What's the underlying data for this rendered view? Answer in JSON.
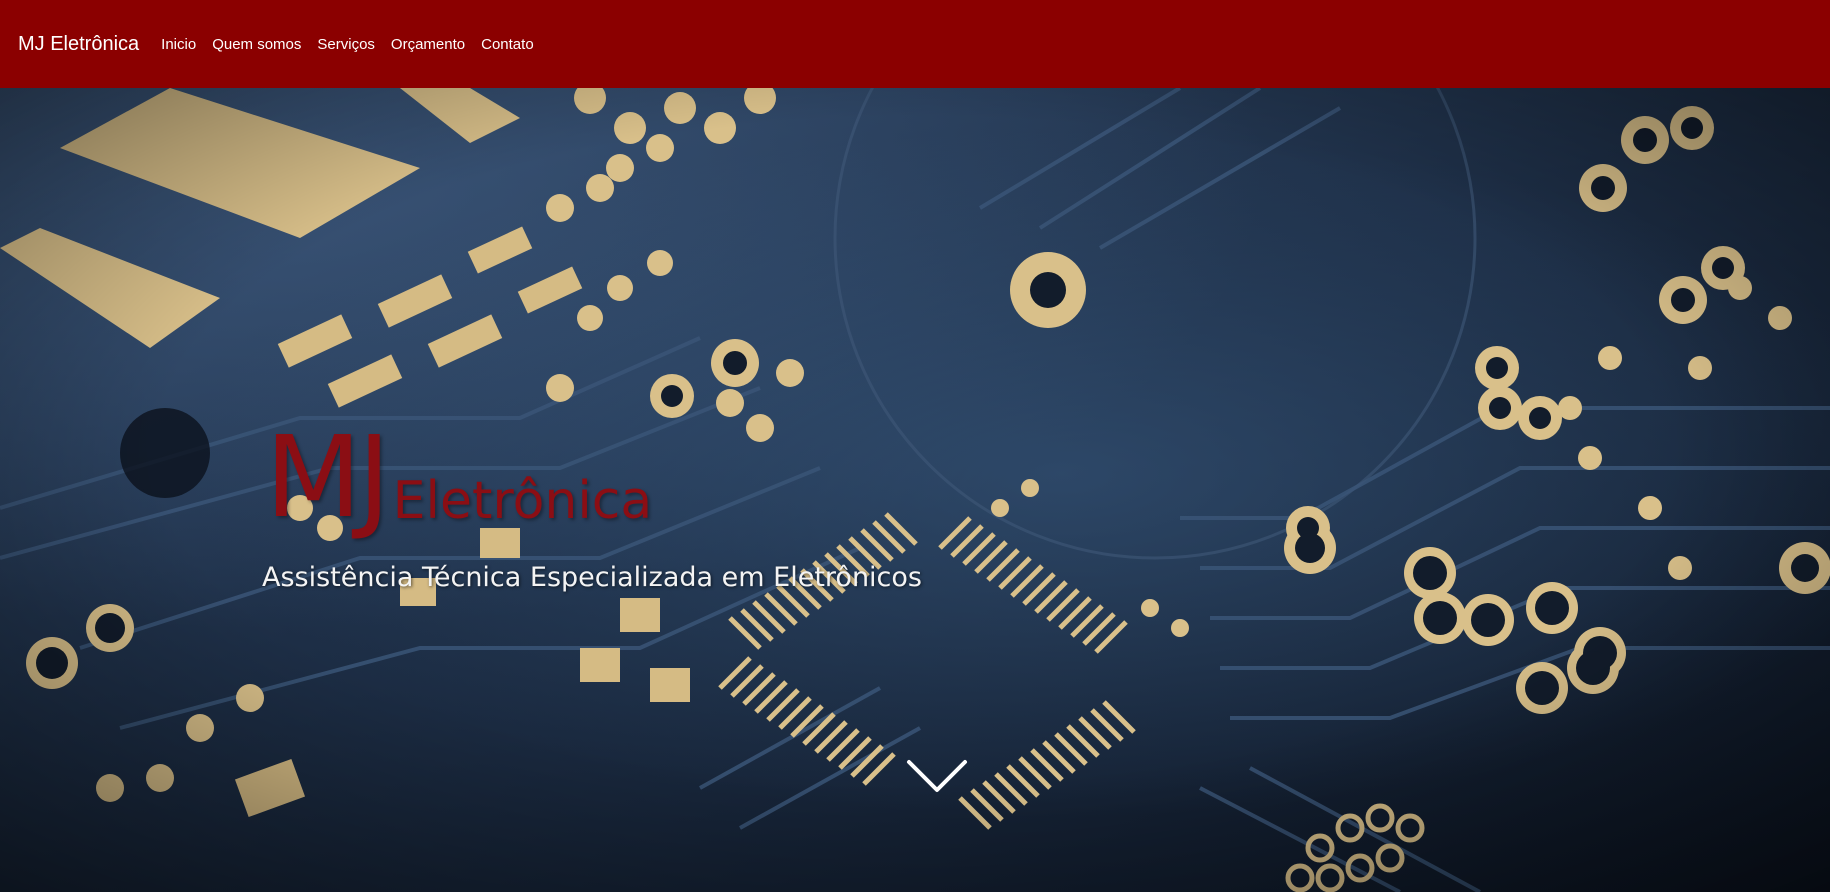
{
  "navbar": {
    "brand": "MJ Eletrônica",
    "links": [
      "Inicio",
      "Quem somos",
      "Serviços",
      "Orçamento",
      "Contato"
    ],
    "background_color": "#8b0000"
  },
  "hero": {
    "logo_main": "MJ",
    "logo_sub": "Eletrônica",
    "tagline": "Assistência Técnica Especializada em Eletrônicos",
    "logo_color": "#8b0e14",
    "scroll_icon": "chevron-down-icon"
  }
}
